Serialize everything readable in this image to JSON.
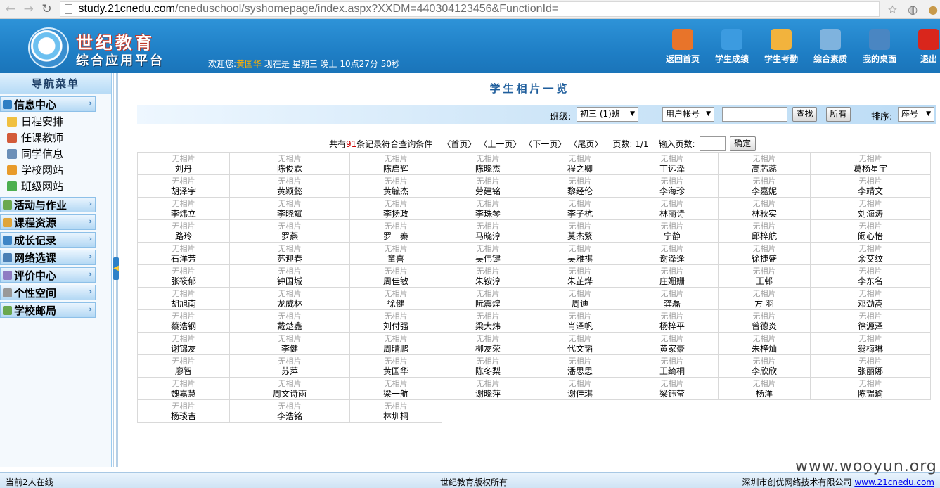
{
  "browser": {
    "url_host": "study.21cnedu.com",
    "url_path": "/cneduschool/syshomepage/index.aspx?XXDM=440304123456&FunctionId="
  },
  "header": {
    "logo_line1": "世纪教育",
    "logo_line2": "综合应用平台",
    "welcome_prefix": "欢迎您:",
    "user_name": "黄国华",
    "welcome_suffix": "现在是 星期三 晚上 10点27分 50秒",
    "nav": [
      {
        "label": "返回首页",
        "icon": "home-icon",
        "color": "#e8742a"
      },
      {
        "label": "学生成绩",
        "icon": "grades-icon",
        "color": "#3c9be0"
      },
      {
        "label": "学生考勤",
        "icon": "attendance-icon",
        "color": "#f2b33d"
      },
      {
        "label": "综合素质",
        "icon": "quality-icon",
        "color": "#7fb3de"
      },
      {
        "label": "我的桌面",
        "icon": "desktop-icon",
        "color": "#4a86c2"
      },
      {
        "label": "退出",
        "icon": "power-icon",
        "color": "#d9261c"
      }
    ]
  },
  "sidebar": {
    "title": "导航菜单",
    "menus": [
      {
        "label": "信息中心",
        "icon": "info-icon",
        "color": "#2f7fc4",
        "sub": [
          {
            "label": "日程安排",
            "icon": "calendar-icon",
            "color": "#f0c040"
          },
          {
            "label": "任课教师",
            "icon": "calendar-grid-icon",
            "color": "#d35b3a"
          },
          {
            "label": "同学信息",
            "icon": "classmates-icon",
            "color": "#6b8fb8"
          },
          {
            "label": "学校网站",
            "icon": "house-icon",
            "color": "#e89b2b"
          },
          {
            "label": "班级网站",
            "icon": "puzzle-icon",
            "color": "#4caf50"
          }
        ]
      },
      {
        "label": "活动与作业",
        "icon": "activity-icon",
        "color": "#6aa84f",
        "sub": []
      },
      {
        "label": "课程资源",
        "icon": "book-icon",
        "color": "#e0a53a",
        "sub": []
      },
      {
        "label": "成长记录",
        "icon": "person-icon",
        "color": "#3d85c6",
        "sub": []
      },
      {
        "label": "网络选课",
        "icon": "monitor-icon",
        "color": "#4a7fb5",
        "sub": []
      },
      {
        "label": "评价中心",
        "icon": "people-icon",
        "color": "#8e7cc3",
        "sub": []
      },
      {
        "label": "个性空间",
        "icon": "database-icon",
        "color": "#999999",
        "sub": []
      },
      {
        "label": "学校邮局",
        "icon": "gear-icon",
        "color": "#6aa84f",
        "sub": []
      }
    ]
  },
  "main": {
    "title": "学生相片一览",
    "filter": {
      "class_label": "班级:",
      "class_value": "初三 (1)班",
      "field_value": "用户帐号",
      "search_label": "查找",
      "all_label": "所有",
      "sort_label": "排序:",
      "sort_value": "座号"
    },
    "pager": {
      "prefix": "共有",
      "count": "91",
      "suffix": "条记录符合查询条件",
      "first": "〈首页〉",
      "prev": "〈上一页〉",
      "next": "〈下一页〉",
      "last": "〈尾页〉",
      "pages": "页数: 1/1",
      "goto_label": "输入页数:",
      "ok_label": "确定"
    },
    "no_photo": "无相片",
    "students": [
      "刘丹",
      "陈俊霖",
      "陈启辉",
      "陈晓杰",
      "程之卿",
      "丁远泽",
      "高芯蕊",
      "葛杨星宇",
      "胡泽宇",
      "黄颖懿",
      "黄毓杰",
      "劳建铭",
      "黎经伦",
      "李海珍",
      "李嘉妮",
      "李靖文",
      "李炜立",
      "李晓斌",
      "李扬政",
      "李珠琴",
      "李子杭",
      "林丽诗",
      "林秋实",
      "刘海涛",
      "路玲",
      "罗燕",
      "罗一秦",
      "马晓淳",
      "莫杰繁",
      "宁静",
      "邱梓航",
      "阚心怡",
      "石洋芳",
      "苏迎春",
      "童喜",
      "吴伟键",
      "吴雅祺",
      "谢泽逢",
      "徐捷盛",
      "余艾纹",
      "张筱郁",
      "钟国城",
      "周佳敏",
      "朱铵淳",
      "朱芷烨",
      "庄姗姗",
      "王邨",
      "李东名",
      "胡旭南",
      "龙威林",
      "徐健",
      "阮震煌",
      "周迪",
      "龚磊",
      "方 羽",
      "邓劲嵩",
      "蔡浩钢",
      "戴楚鑫",
      "刘付强",
      "梁大炜",
      "肖泽帆",
      "杨梓平",
      "曾德炎",
      "徐源泽",
      "谢锦友",
      "李健",
      "周晴鹏",
      "柳友荣",
      "代文韬",
      "黄家豪",
      "朱梓灿",
      "翁梅琳",
      "廖智",
      "苏萍",
      "黄国华",
      "陈冬梨",
      "潘思思",
      "王绮桐",
      "李欣欣",
      "张丽娜",
      "魏嘉慧",
      "周文诗雨",
      "梁一航",
      "谢晓萍",
      "谢佳琪",
      "梁钰莹",
      "杨洋",
      "陈韫瑜",
      "杨琰吉",
      "李浩铭",
      "林圳桐"
    ]
  },
  "footer": {
    "online": "当前2人在线",
    "copyright": "世纪教育版权所有",
    "company": "深圳市创优网络技术有限公司",
    "company_link": "www.21cnedu.com"
  },
  "watermark": "www.wooyun.org"
}
